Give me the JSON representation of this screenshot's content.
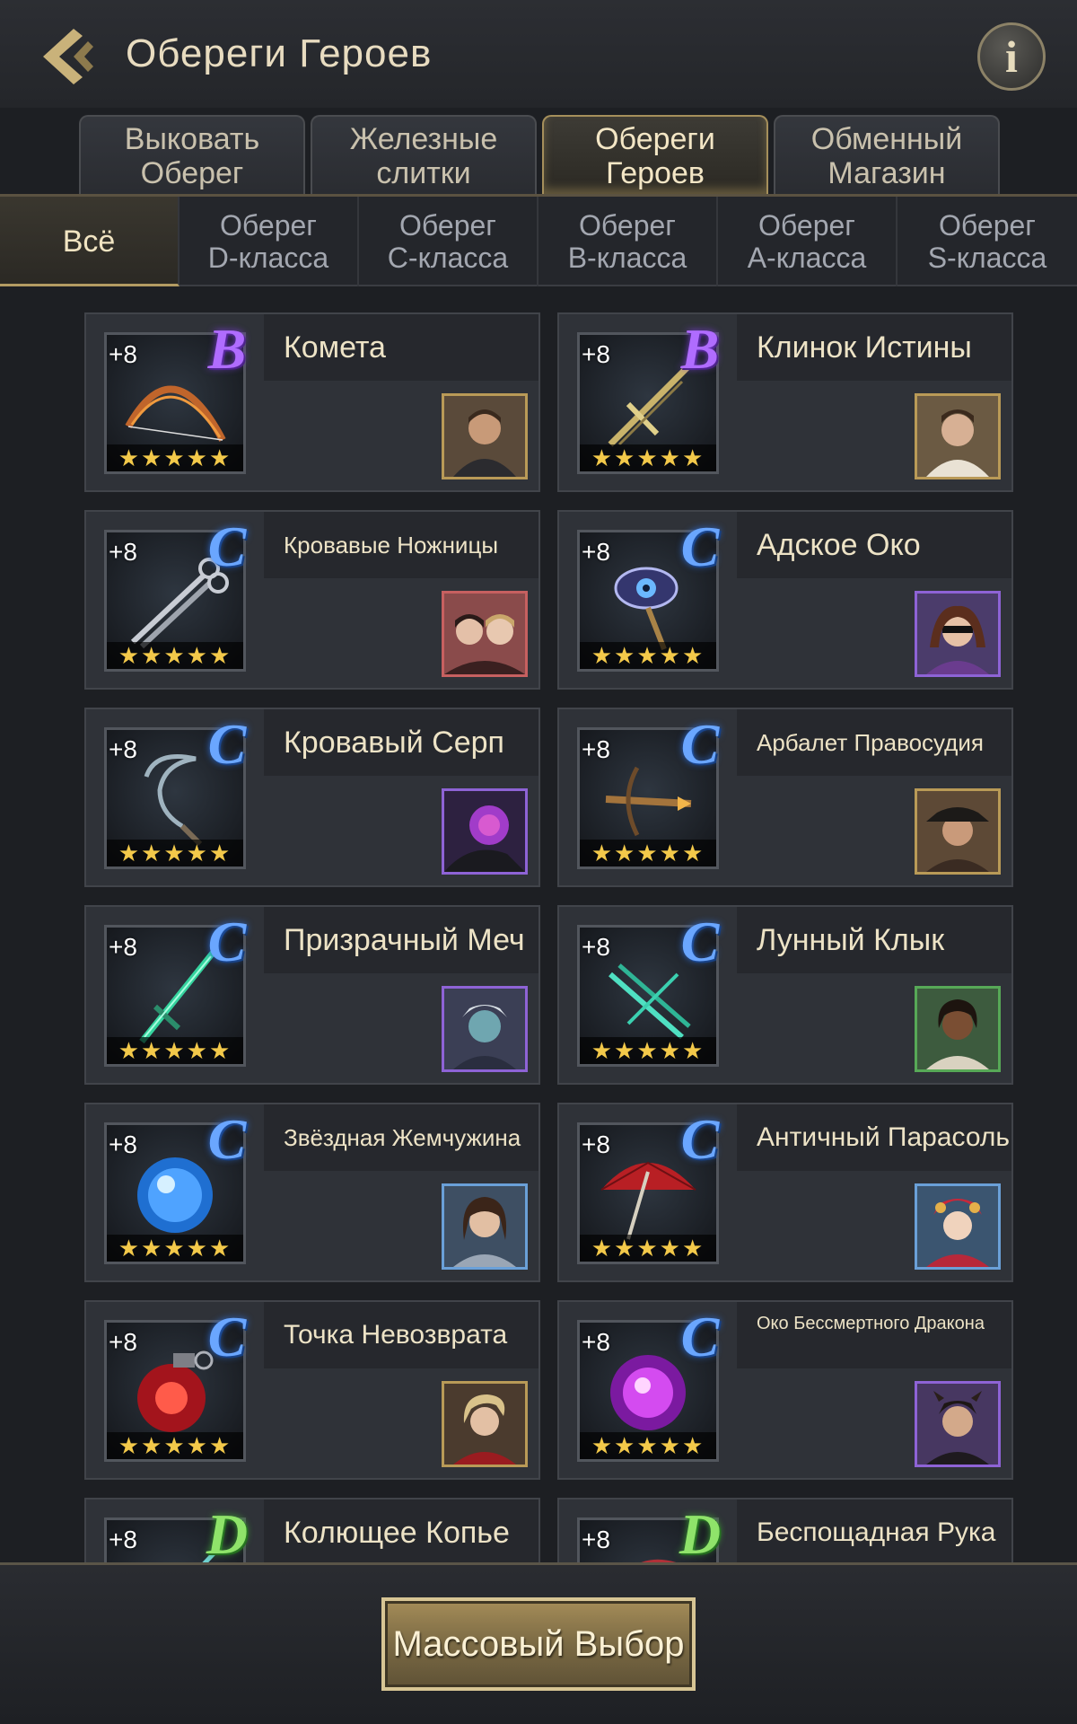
{
  "header": {
    "title": "Обереги Героев",
    "info_label": "i"
  },
  "tabs": [
    {
      "label_line1": "Выковать",
      "label_line2": "Оберег"
    },
    {
      "label_line1": "Железные",
      "label_line2": "слитки"
    },
    {
      "label_line1": "Обереги",
      "label_line2": "Героев"
    },
    {
      "label_line1": "Обменный",
      "label_line2": "Магазин"
    }
  ],
  "filters": [
    {
      "line1": "Всё",
      "line2": ""
    },
    {
      "line1": "Оберег",
      "line2": "D-класса"
    },
    {
      "line1": "Оберег",
      "line2": "C-класса"
    },
    {
      "line1": "Оберег",
      "line2": "B-класса"
    },
    {
      "line1": "Оберег",
      "line2": "A-класса"
    },
    {
      "line1": "Оберег",
      "line2": "S-класса"
    }
  ],
  "cards": [
    {
      "name": "Комета",
      "grade": "B",
      "level": "+8",
      "stars": "★★★★★",
      "icon": "bow-icon",
      "hero": "hero-portrait"
    },
    {
      "name": "Клинок Истины",
      "grade": "B",
      "level": "+8",
      "stars": "★★★★★",
      "icon": "sword-icon",
      "hero": "hero-portrait"
    },
    {
      "name": "Кровавые Ножницы",
      "grade": "C",
      "level": "+8",
      "stars": "★★★★★",
      "icon": "scissors-icon",
      "hero": "hero-portrait"
    },
    {
      "name": "Адское Око",
      "grade": "C",
      "level": "+8",
      "stars": "★★★★★",
      "icon": "eye-staff-icon",
      "hero": "hero-portrait"
    },
    {
      "name": "Кровавый Серп",
      "grade": "C",
      "level": "+8",
      "stars": "★★★★★",
      "icon": "sickle-icon",
      "hero": "hero-portrait"
    },
    {
      "name": "Арбалет Правосудия",
      "grade": "C",
      "level": "+8",
      "stars": "★★★★★",
      "icon": "crossbow-icon",
      "hero": "hero-portrait"
    },
    {
      "name": "Призрачный Меч",
      "grade": "C",
      "level": "+8",
      "stars": "★★★★★",
      "icon": "ghost-sword-icon",
      "hero": "hero-portrait"
    },
    {
      "name": "Лунный Клык",
      "grade": "C",
      "level": "+8",
      "stars": "★★★★★",
      "icon": "twin-blades-icon",
      "hero": "hero-portrait"
    },
    {
      "name": "Звёздная Жемчужина",
      "grade": "C",
      "level": "+8",
      "stars": "★★★★★",
      "icon": "orb-icon",
      "hero": "hero-portrait"
    },
    {
      "name": "Античный Парасоль",
      "grade": "C",
      "level": "+8",
      "stars": "★★★★★",
      "icon": "parasol-icon",
      "hero": "hero-portrait"
    },
    {
      "name": "Точка Невозврата",
      "grade": "C",
      "level": "+8",
      "stars": "★★★★★",
      "icon": "grenade-icon",
      "hero": "hero-portrait"
    },
    {
      "name": "Око Бессмертного Дракона",
      "grade": "C",
      "level": "+8",
      "stars": "★★★★★",
      "icon": "dragon-orb-icon",
      "hero": "hero-portrait"
    },
    {
      "name": "Колющее Копье",
      "grade": "D",
      "level": "+8",
      "stars": "★★★★★",
      "icon": "spear-icon",
      "hero": "hero-portrait"
    },
    {
      "name": "Беспощадная Рука",
      "grade": "D",
      "level": "+8",
      "stars": "★★★★★",
      "icon": "claw-icon",
      "hero": "hero-portrait"
    }
  ],
  "bottom": {
    "mass_select_label": "Массовый Выбор"
  }
}
